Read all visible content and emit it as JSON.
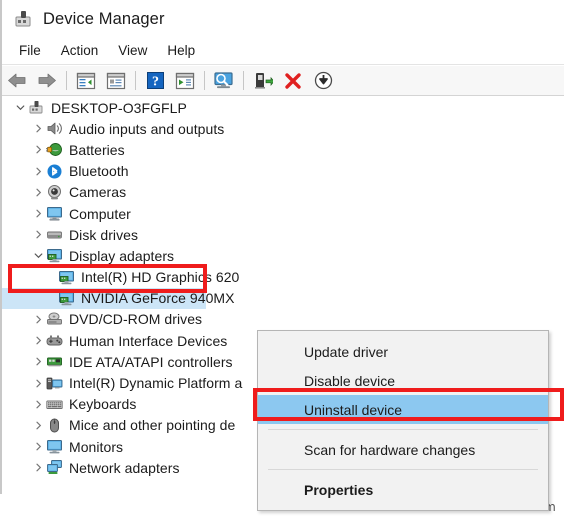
{
  "window": {
    "title": "Device Manager",
    "title_icon": "device-manager-icon"
  },
  "menubar": {
    "items": [
      {
        "label": "File"
      },
      {
        "label": "Action"
      },
      {
        "label": "View"
      },
      {
        "label": "Help"
      }
    ]
  },
  "toolbar": {
    "buttons": [
      {
        "name": "back-button",
        "icon": "left-arrow-icon"
      },
      {
        "name": "forward-button",
        "icon": "right-arrow-icon"
      },
      {
        "name": "separator-1",
        "icon": "separator"
      },
      {
        "name": "show-hide-console-tree-button",
        "icon": "console-tree-icon"
      },
      {
        "name": "properties-button",
        "icon": "properties-window-icon"
      },
      {
        "name": "separator-2",
        "icon": "separator"
      },
      {
        "name": "help-button",
        "icon": "question-mark-icon"
      },
      {
        "name": "update-driver-button",
        "icon": "driver-update-icon"
      },
      {
        "name": "separator-3",
        "icon": "separator"
      },
      {
        "name": "scan-for-hardware-changes-button",
        "icon": "scan-monitor-icon"
      },
      {
        "name": "separator-4",
        "icon": "separator"
      },
      {
        "name": "enable-device-button",
        "icon": "enable-device-icon"
      },
      {
        "name": "uninstall-device-button",
        "icon": "red-x-icon"
      },
      {
        "name": "disable-device-button",
        "icon": "down-arrow-circle-icon"
      }
    ]
  },
  "tree": {
    "nodes": [
      {
        "label": "DESKTOP-O3FGFLP",
        "indent": 0,
        "expander": "expanded",
        "icon": "computer-device-icon",
        "selected": false
      },
      {
        "label": "Audio inputs and outputs",
        "indent": 1,
        "expander": "collapsed",
        "icon": "speaker-icon",
        "selected": false
      },
      {
        "label": "Batteries",
        "indent": 1,
        "expander": "collapsed",
        "icon": "battery-plug-icon",
        "selected": false
      },
      {
        "label": "Bluetooth",
        "indent": 1,
        "expander": "collapsed",
        "icon": "bluetooth-icon",
        "selected": false
      },
      {
        "label": "Cameras",
        "indent": 1,
        "expander": "collapsed",
        "icon": "camera-icon",
        "selected": false
      },
      {
        "label": "Computer",
        "indent": 1,
        "expander": "collapsed",
        "icon": "monitor-icon",
        "selected": false
      },
      {
        "label": "Disk drives",
        "indent": 1,
        "expander": "collapsed",
        "icon": "disk-drive-icon",
        "selected": false
      },
      {
        "label": "Display adapters",
        "indent": 1,
        "expander": "expanded",
        "icon": "display-adapter-icon",
        "selected": false
      },
      {
        "label": "Intel(R) HD Graphics 620",
        "indent": 2,
        "expander": "none",
        "icon": "display-adapter-icon",
        "selected": false
      },
      {
        "label": "NVIDIA GeForce 940MX",
        "indent": 2,
        "expander": "none",
        "icon": "display-adapter-icon",
        "selected": true
      },
      {
        "label": "DVD/CD-ROM drives",
        "indent": 1,
        "expander": "collapsed",
        "icon": "optical-drive-icon",
        "selected": false
      },
      {
        "label": "Human Interface Devices",
        "indent": 1,
        "expander": "collapsed",
        "icon": "gamepad-icon",
        "selected": false
      },
      {
        "label": "IDE ATA/ATAPI controllers",
        "indent": 1,
        "expander": "collapsed",
        "icon": "ide-controller-icon",
        "selected": false
      },
      {
        "label": "Intel(R) Dynamic Platform a",
        "indent": 1,
        "expander": "collapsed",
        "icon": "platform-device-icon",
        "selected": false
      },
      {
        "label": "Keyboards",
        "indent": 1,
        "expander": "collapsed",
        "icon": "keyboard-icon",
        "selected": false
      },
      {
        "label": "Mice and other pointing de",
        "indent": 1,
        "expander": "collapsed",
        "icon": "mouse-icon",
        "selected": false
      },
      {
        "label": "Monitors",
        "indent": 1,
        "expander": "collapsed",
        "icon": "monitor-icon",
        "selected": false
      },
      {
        "label": "Network adapters",
        "indent": 1,
        "expander": "collapsed",
        "icon": "network-adapter-icon",
        "selected": false
      }
    ]
  },
  "context_menu": {
    "items": [
      {
        "label": "Update driver",
        "type": "item",
        "highlighted": false,
        "bold": false
      },
      {
        "label": "Disable device",
        "type": "item",
        "highlighted": false,
        "bold": false
      },
      {
        "label": "Uninstall device",
        "type": "item",
        "highlighted": true,
        "bold": false
      },
      {
        "label": "",
        "type": "separator",
        "highlighted": false,
        "bold": false
      },
      {
        "label": "Scan for hardware changes",
        "type": "item",
        "highlighted": false,
        "bold": false
      },
      {
        "label": "",
        "type": "separator",
        "highlighted": false,
        "bold": false
      },
      {
        "label": "Properties",
        "type": "item",
        "highlighted": false,
        "bold": true
      }
    ]
  },
  "annotations": {
    "boxes": [
      {
        "name": "display-adapters-highlight-box",
        "color": "#ef1c1c"
      },
      {
        "name": "uninstall-device-highlight-box",
        "color": "#ef1c1c"
      }
    ]
  },
  "watermark": {
    "text": "wsxdn.com"
  },
  "colors": {
    "selection_blue": "#cce5f7",
    "menu_highlight_blue": "#8cc8f0",
    "annotation_red": "#ef1c1c",
    "toolbar_bg": "#f7f7f7",
    "menu_bg": "#f2f2f2"
  }
}
